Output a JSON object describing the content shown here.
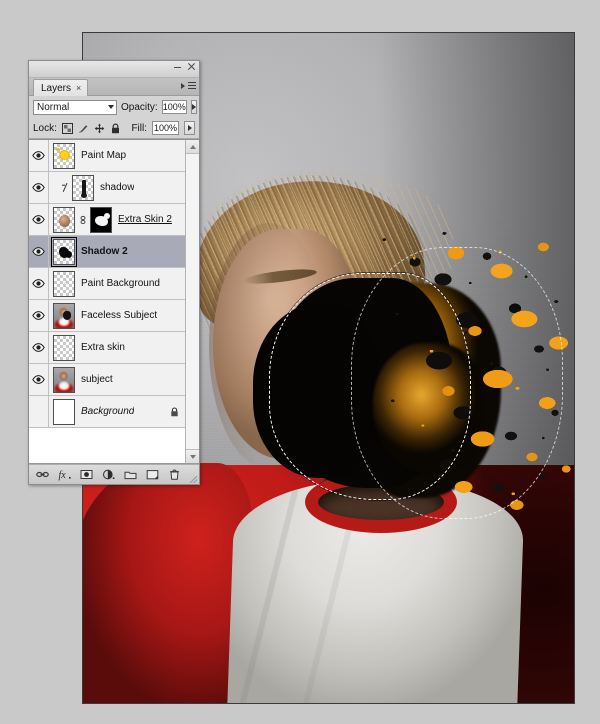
{
  "app": {
    "window_controls": {
      "minimize": "minimize-button",
      "close": "close-button"
    }
  },
  "panel": {
    "tab_label": "Layers",
    "tab_close": "×",
    "blend_mode": "Normal",
    "opacity_label": "Opacity:",
    "opacity_value": "100%",
    "lock_label": "Lock:",
    "fill_label": "Fill:",
    "fill_value": "100%",
    "lock_icons": [
      "lock-transparent-pixels-icon",
      "lock-image-pixels-icon",
      "lock-position-icon",
      "lock-all-icon"
    ],
    "layers": [
      {
        "name": "Paint Map",
        "visible": true,
        "selected": false,
        "style": "normal",
        "thumb": "paint-map",
        "has_mask": false,
        "locked": false,
        "indented": false
      },
      {
        "name": "shadow",
        "visible": true,
        "selected": false,
        "style": "normal",
        "thumb": "shadow-bar",
        "has_mask": false,
        "locked": false,
        "indented": true
      },
      {
        "name": "Extra Skin 2",
        "visible": true,
        "selected": false,
        "style": "underline",
        "thumb": "skin",
        "has_mask": true,
        "locked": false,
        "indented": false
      },
      {
        "name": "Shadow 2",
        "visible": true,
        "selected": true,
        "style": "bold",
        "thumb": "shadow-blob",
        "has_mask": false,
        "locked": false,
        "indented": false
      },
      {
        "name": "Paint Background",
        "visible": true,
        "selected": false,
        "style": "normal",
        "thumb": "empty-q",
        "has_mask": false,
        "locked": false,
        "indented": false
      },
      {
        "name": "Faceless Subject",
        "visible": true,
        "selected": false,
        "style": "normal",
        "thumb": "person-faceless",
        "has_mask": false,
        "locked": false,
        "indented": false
      },
      {
        "name": "Extra skin",
        "visible": true,
        "selected": false,
        "style": "normal",
        "thumb": "empty",
        "has_mask": false,
        "locked": false,
        "indented": false
      },
      {
        "name": "subject",
        "visible": true,
        "selected": false,
        "style": "normal",
        "thumb": "person",
        "has_mask": false,
        "locked": false,
        "indented": false
      },
      {
        "name": "Background",
        "visible": false,
        "selected": false,
        "style": "italic",
        "thumb": "white",
        "has_mask": false,
        "locked": true,
        "indented": false
      }
    ],
    "footer_icons": [
      "link-layers-icon",
      "layer-style-fx-icon",
      "add-layer-mask-icon",
      "new-adjustment-layer-icon",
      "new-group-icon",
      "new-layer-icon",
      "delete-layer-icon"
    ]
  },
  "colors": {
    "panel_bg": "#d4d4d4",
    "selected_row": "#a8aab8",
    "paint_orange": "#f0a01a",
    "paint_black": "#0a0a0a",
    "shirt_red": "#bf1b18",
    "canvas_bg": "#c9c9c9"
  },
  "canvas": {
    "description": "Photograph of a person in a red-and-white raglan baseball shirt; the face is replaced by a black and orange paint splatter with an active marching-ants selection."
  }
}
